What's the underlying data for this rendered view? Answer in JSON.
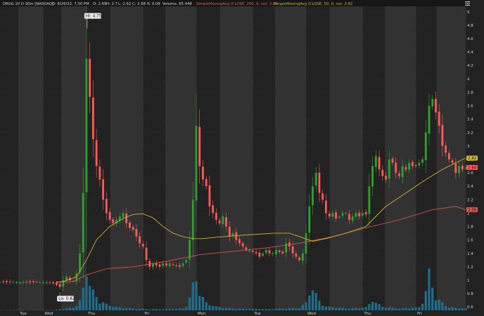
{
  "header": {
    "symbol": "DRUG 10 D 30m [NASDAQ]",
    "date": "D: 8/26/22, 7:30 PM",
    "open": "O: 2.69",
    "high": "H: 2.7",
    "low": "L: 2.62",
    "close": "C: 2.68",
    "change": "R: 0.08",
    "volume": "Volume: 85.448",
    "sma200_label": "SimpleMovingAvg (CLOSE, 200, 0, no): 2.05",
    "sma50_label": "SimpleMovingAvg (CLOSE, 50, 0, no): 2.82"
  },
  "callouts": {
    "hi": "Hi: 4.75",
    "lo": "Lo: 0.82"
  },
  "badges": {
    "sma50": "2.82",
    "close": "2.68",
    "sma200": "2.05"
  },
  "colors": {
    "up": "#2fa12f",
    "down": "#ff5a5a",
    "sma50": "#c8b42a",
    "sma200": "#d9534f",
    "volume": "#1f6e8c",
    "bg_day": "#222222",
    "bg_night": "#323232",
    "grid": "#3b3b3b"
  },
  "chart_data": {
    "type": "candlestick",
    "timeframe": "30m",
    "days": [
      "Tue",
      "Wed",
      "Thu",
      "Fri",
      "Mon",
      "Tue",
      "Wed",
      "Thu",
      "Fri"
    ],
    "y_ticks": [
      "5",
      "4.8",
      "4.6",
      "4.4",
      "4.2",
      "4",
      "3.8",
      "3.6",
      "3.4",
      "3.2",
      "3",
      "2.8",
      "2.6",
      "2.4",
      "2.2",
      "2",
      "1.8",
      "1.6",
      "1.4",
      "1.2",
      "1",
      "0.8",
      "0.6"
    ],
    "ylim": [
      0.55,
      5.05
    ],
    "close_path": [
      [
        0,
        0.97
      ],
      [
        3,
        0.97
      ],
      [
        6,
        0.97
      ],
      [
        10,
        0.97
      ],
      [
        14,
        0.97
      ],
      [
        16,
        0.95
      ],
      [
        17,
        0.93
      ],
      [
        18,
        0.9
      ],
      [
        19,
        1.0
      ],
      [
        20,
        1.05
      ],
      [
        21,
        1.0
      ],
      [
        22,
        0.98
      ],
      [
        23,
        1.1
      ],
      [
        24,
        1.4
      ],
      [
        25,
        2.3
      ],
      [
        25.6,
        3.4
      ],
      [
        26.2,
        4.75
      ],
      [
        26.8,
        3.8
      ],
      [
        27.4,
        3.6
      ],
      [
        28,
        3.1
      ],
      [
        29,
        2.7
      ],
      [
        30,
        2.5
      ],
      [
        31,
        2.2
      ],
      [
        32,
        2.0
      ],
      [
        33,
        1.9
      ],
      [
        34,
        1.85
      ],
      [
        35,
        1.9
      ],
      [
        36,
        1.95
      ],
      [
        37,
        2.0
      ],
      [
        38,
        1.85
      ],
      [
        39,
        1.78
      ],
      [
        40,
        1.75
      ],
      [
        41,
        1.65
      ],
      [
        42,
        1.55
      ],
      [
        43,
        1.5
      ],
      [
        44,
        1.3
      ],
      [
        45,
        1.2
      ],
      [
        46,
        1.25
      ],
      [
        47,
        1.22
      ],
      [
        48,
        1.2
      ],
      [
        49,
        1.25
      ],
      [
        50,
        1.22
      ],
      [
        51,
        1.25
      ],
      [
        52,
        1.23
      ],
      [
        53,
        1.22
      ],
      [
        54,
        1.2
      ],
      [
        55,
        1.25
      ],
      [
        56,
        1.3
      ],
      [
        57,
        1.6
      ],
      [
        58,
        2.2
      ],
      [
        58.6,
        3.1
      ],
      [
        59.2,
        3.4
      ],
      [
        60,
        2.7
      ],
      [
        61,
        2.5
      ],
      [
        62,
        2.4
      ],
      [
        63,
        2.1
      ],
      [
        64,
        2.0
      ],
      [
        65,
        1.9
      ],
      [
        66,
        1.85
      ],
      [
        67,
        1.95
      ],
      [
        68,
        1.8
      ],
      [
        69,
        1.65
      ],
      [
        70,
        1.7
      ],
      [
        71,
        1.6
      ],
      [
        72,
        1.55
      ],
      [
        73,
        1.5
      ],
      [
        74,
        1.45
      ],
      [
        75,
        1.45
      ],
      [
        76,
        1.42
      ],
      [
        77,
        1.4
      ],
      [
        78,
        1.35
      ],
      [
        79,
        1.4
      ],
      [
        80,
        1.45
      ],
      [
        81,
        1.4
      ],
      [
        82,
        1.4
      ],
      [
        83,
        1.45
      ],
      [
        84,
        1.42
      ],
      [
        85,
        1.4
      ],
      [
        86,
        1.55
      ],
      [
        87,
        1.5
      ],
      [
        88,
        1.4
      ],
      [
        89,
        1.35
      ],
      [
        90,
        1.3
      ],
      [
        91,
        1.4
      ],
      [
        92,
        1.7
      ],
      [
        93,
        2.1
      ],
      [
        94,
        2.4
      ],
      [
        95,
        2.6
      ],
      [
        96,
        2.3
      ],
      [
        97,
        2.2
      ],
      [
        98,
        2.0
      ],
      [
        99,
        1.95
      ],
      [
        100,
        2.0
      ],
      [
        101,
        1.92
      ],
      [
        102,
        1.95
      ],
      [
        103,
        2.0
      ],
      [
        104,
        2.0
      ],
      [
        105,
        1.9
      ],
      [
        106,
        1.95
      ],
      [
        107,
        2.0
      ],
      [
        108,
        1.95
      ],
      [
        109,
        2.0
      ],
      [
        110,
        1.98
      ],
      [
        111,
        2.4
      ],
      [
        112,
        2.7
      ],
      [
        113,
        2.85
      ],
      [
        114,
        2.65
      ],
      [
        115,
        2.55
      ],
      [
        116,
        2.5
      ],
      [
        117,
        2.8
      ],
      [
        118,
        2.75
      ],
      [
        119,
        2.6
      ],
      [
        120,
        2.55
      ],
      [
        121,
        2.7
      ],
      [
        122,
        2.65
      ],
      [
        123,
        2.75
      ],
      [
        124,
        2.7
      ],
      [
        125,
        2.7
      ],
      [
        126,
        2.75
      ],
      [
        127,
        2.8
      ],
      [
        128,
        3.2
      ],
      [
        129,
        3.6
      ],
      [
        129.6,
        4.0
      ],
      [
        130,
        3.7
      ],
      [
        131,
        3.5
      ],
      [
        132,
        3.3
      ],
      [
        133,
        3.0
      ],
      [
        134,
        2.9
      ],
      [
        135,
        2.8
      ],
      [
        136,
        2.75
      ],
      [
        137,
        2.6
      ],
      [
        138,
        2.7
      ],
      [
        139,
        2.65
      ],
      [
        140,
        2.68
      ]
    ],
    "sma50": [
      [
        17,
        0.97
      ],
      [
        19,
        0.98
      ],
      [
        23,
        1.05
      ],
      [
        26,
        1.3
      ],
      [
        29,
        1.6
      ],
      [
        33,
        1.8
      ],
      [
        37,
        1.92
      ],
      [
        40,
        1.98
      ],
      [
        43,
        1.99
      ],
      [
        46,
        1.93
      ],
      [
        49,
        1.8
      ],
      [
        52,
        1.7
      ],
      [
        55,
        1.65
      ],
      [
        58,
        1.62
      ],
      [
        61,
        1.62
      ],
      [
        65,
        1.64
      ],
      [
        70,
        1.66
      ],
      [
        76,
        1.68
      ],
      [
        82,
        1.7
      ],
      [
        87,
        1.7
      ],
      [
        90,
        1.65
      ],
      [
        94,
        1.58
      ],
      [
        98,
        1.62
      ],
      [
        104,
        1.7
      ],
      [
        110,
        1.8
      ],
      [
        116,
        2.1
      ],
      [
        122,
        2.3
      ],
      [
        128,
        2.5
      ],
      [
        133,
        2.65
      ],
      [
        137,
        2.75
      ],
      [
        140,
        2.82
      ]
    ],
    "sma200": [
      [
        17,
        0.97
      ],
      [
        22,
        0.98
      ],
      [
        26,
        1.08
      ],
      [
        32,
        1.17
      ],
      [
        40,
        1.2
      ],
      [
        50,
        1.28
      ],
      [
        60,
        1.38
      ],
      [
        70,
        1.43
      ],
      [
        80,
        1.48
      ],
      [
        90,
        1.55
      ],
      [
        100,
        1.65
      ],
      [
        110,
        1.78
      ],
      [
        120,
        1.9
      ],
      [
        130,
        2.05
      ],
      [
        137,
        2.1
      ],
      [
        140,
        2.05
      ]
    ],
    "volume_path": [
      [
        0,
        0.0
      ],
      [
        16,
        0.0
      ],
      [
        18,
        0.02
      ],
      [
        20,
        0.03
      ],
      [
        22,
        0.05
      ],
      [
        23,
        0.08
      ],
      [
        24,
        0.15
      ],
      [
        25,
        0.35
      ],
      [
        26,
        0.75
      ],
      [
        27,
        0.4
      ],
      [
        28,
        0.3
      ],
      [
        29,
        0.22
      ],
      [
        30,
        0.15
      ],
      [
        32,
        0.1
      ],
      [
        35,
        0.05
      ],
      [
        40,
        0.03
      ],
      [
        45,
        0.02
      ],
      [
        50,
        0.02
      ],
      [
        55,
        0.03
      ],
      [
        56,
        0.08
      ],
      [
        57,
        0.2
      ],
      [
        58,
        0.4
      ],
      [
        59,
        0.5
      ],
      [
        60,
        0.3
      ],
      [
        61,
        0.2
      ],
      [
        62,
        0.12
      ],
      [
        65,
        0.06
      ],
      [
        70,
        0.03
      ],
      [
        80,
        0.02
      ],
      [
        90,
        0.04
      ],
      [
        92,
        0.12
      ],
      [
        93,
        0.3
      ],
      [
        94,
        0.35
      ],
      [
        95,
        0.25
      ],
      [
        96,
        0.15
      ],
      [
        98,
        0.06
      ],
      [
        105,
        0.03
      ],
      [
        110,
        0.05
      ],
      [
        111,
        0.1
      ],
      [
        112,
        0.2
      ],
      [
        113,
        0.12
      ],
      [
        115,
        0.06
      ],
      [
        120,
        0.03
      ],
      [
        126,
        0.05
      ],
      [
        127,
        0.15
      ],
      [
        128,
        0.3
      ],
      [
        129,
        0.6
      ],
      [
        130,
        0.4
      ],
      [
        131,
        0.2
      ],
      [
        133,
        0.12
      ],
      [
        135,
        0.05
      ],
      [
        140,
        0.03
      ]
    ]
  }
}
